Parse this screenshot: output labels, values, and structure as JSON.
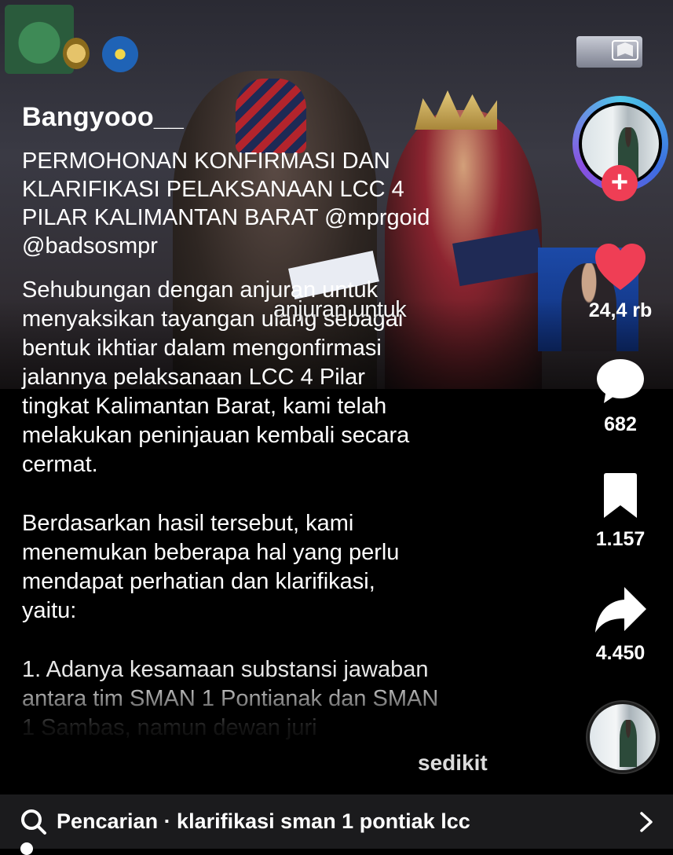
{
  "video": {
    "overlay_subtitle": "anjuran untuk"
  },
  "caption": {
    "username": "Bangyooo__",
    "title": "PERMOHONAN KONFIRMASI DAN\nKLARIFIKASI PELAKSANAAN LCC 4\nPILAR KALIMANTAN BARAT @mprgoid\n@badsosmpr",
    "paragraph_1": "Sehubungan dengan anjuran untuk\nmenyaksikan tayangan ulang sebagai\nbentuk ikhtiar dalam mengonfirmasi\njalannya pelaksanaan LCC 4 Pilar\ntingkat Kalimantan Barat, kami telah\nmelakukan peninjauan kembali secara\ncermat.",
    "paragraph_2": "Berdasarkan hasil tersebut, kami\nmenemukan beberapa hal yang perlu\nmendapat perhatian dan klarifikasi,\nyaitu:",
    "paragraph_3": "1. Adanya kesamaan substansi jawaban\nantara tim SMAN 1 Pontianak dan SMAN\n1 Sambas, namun dewan juri",
    "less_label": "sedikit"
  },
  "actions": {
    "follow_symbol": "+",
    "likes": "24,4 rb",
    "comments": "682",
    "bookmarks": "1.157",
    "shares": "4.450"
  },
  "search": {
    "text": "Pencarian · klarifikasi sman 1 pontiak lcc"
  },
  "colors": {
    "like": "#ef3e55",
    "follow": "#ef3e55",
    "search_bar_bg": "#1b1b1d"
  },
  "icons": [
    "search-icon",
    "heart-icon",
    "comment-icon",
    "bookmark-icon",
    "share-icon",
    "chevron-right-icon",
    "plus-icon"
  ]
}
